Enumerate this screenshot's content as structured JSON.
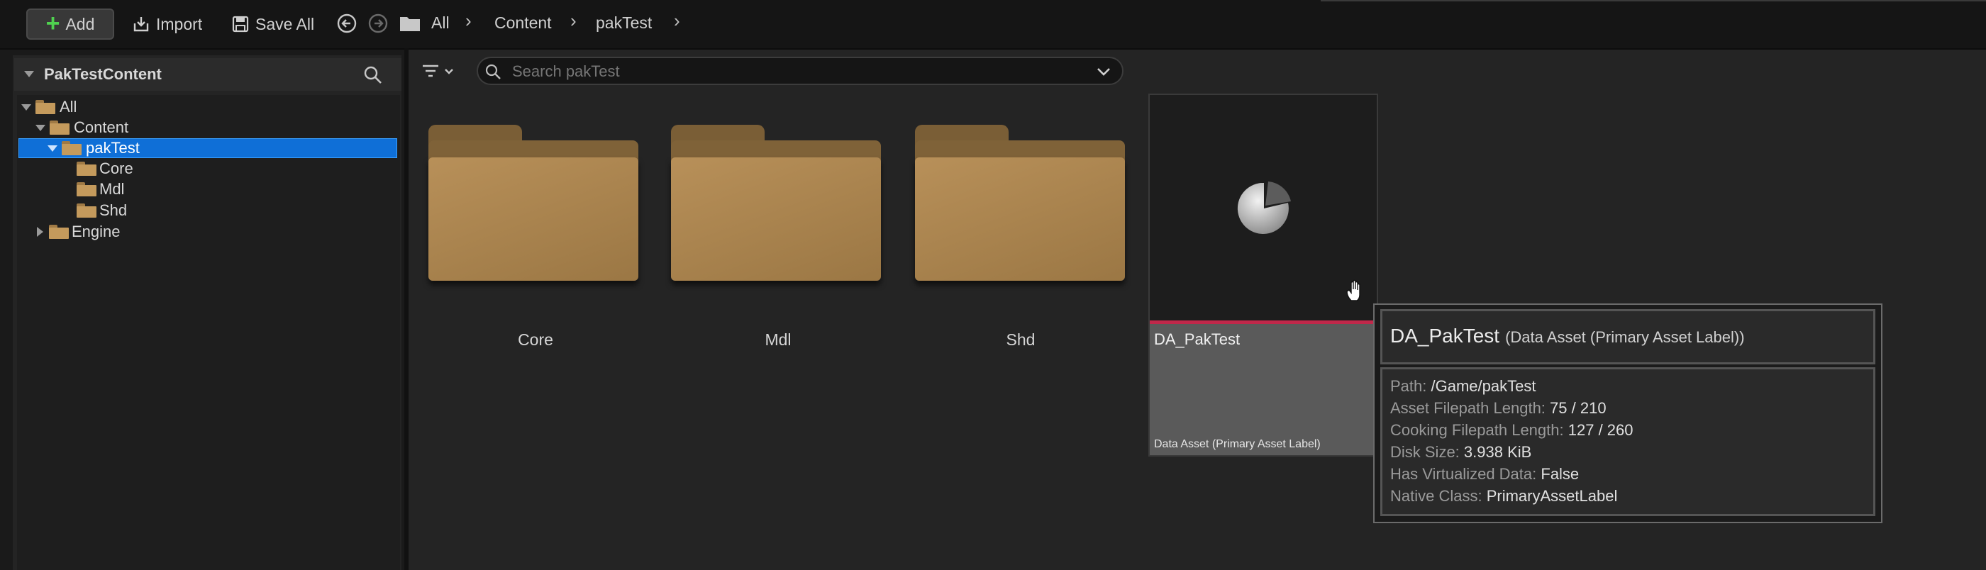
{
  "toolbar": {
    "add_label": "Add",
    "import_label": "Import",
    "save_all_label": "Save All",
    "breadcrumb": [
      "All",
      "Content",
      "pakTest"
    ]
  },
  "left_panel": {
    "title": "PakTestContent",
    "tree": [
      {
        "label": "All",
        "expanded": true
      },
      {
        "label": "Content",
        "expanded": true
      },
      {
        "label": "pakTest",
        "expanded": true,
        "selected": true
      },
      {
        "label": "Core"
      },
      {
        "label": "Mdl"
      },
      {
        "label": "Shd"
      },
      {
        "label": "Engine",
        "expanded": false
      }
    ]
  },
  "search": {
    "placeholder": "Search pakTest"
  },
  "folders": [
    {
      "label": "Core"
    },
    {
      "label": "Mdl"
    },
    {
      "label": "Shd"
    }
  ],
  "asset": {
    "name": "DA_PakTest",
    "type": "Data Asset (Primary Asset Label)"
  },
  "tooltip": {
    "title": "DA_PakTest",
    "subtitle": "(Data Asset (Primary Asset Label))",
    "rows": [
      {
        "key": "Path:",
        "value": "/Game/pakTest"
      },
      {
        "key": "Asset Filepath Length:",
        "value": "75 / 210"
      },
      {
        "key": "Cooking Filepath Length:",
        "value": "127 / 260"
      },
      {
        "key": "Disk Size:",
        "value": "3.938 KiB"
      },
      {
        "key": "Has Virtualized Data:",
        "value": "False"
      },
      {
        "key": "Native Class:",
        "value": "PrimaryAssetLabel"
      }
    ]
  },
  "colors": {
    "accent_selection": "#0f6fd7",
    "add_icon": "#4fd14f",
    "asset_type_line": "#c0284a",
    "folder": "#b89059"
  }
}
